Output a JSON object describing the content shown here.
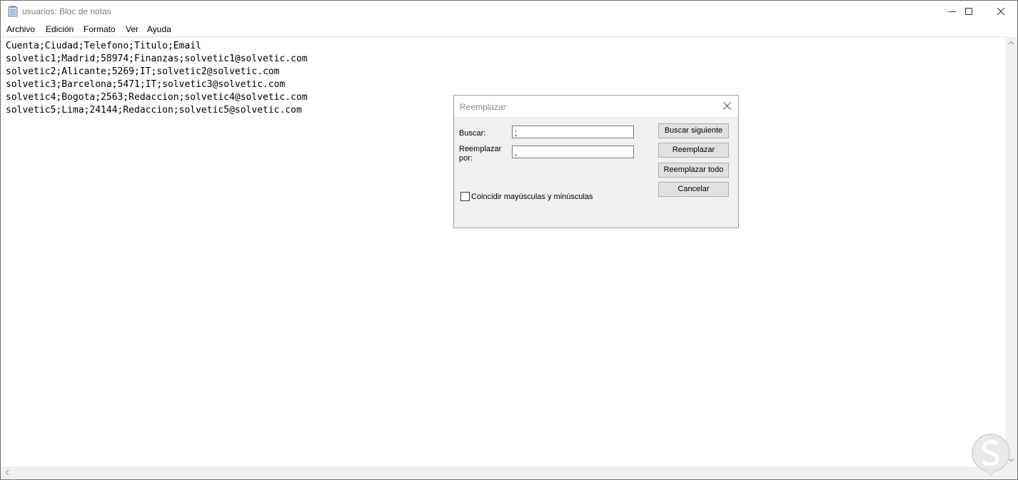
{
  "window": {
    "title": "usuarios: Bloc de notas",
    "icon": "notepad-icon",
    "controls": [
      "minimize-icon",
      "maximize-icon",
      "close-icon"
    ]
  },
  "menu": {
    "items": [
      {
        "label": "Archivo"
      },
      {
        "label": "Edición"
      },
      {
        "label": "Formato"
      },
      {
        "label": "Ver"
      },
      {
        "label": "Ayuda"
      }
    ]
  },
  "editor": {
    "lines": [
      "Cuenta;Ciudad;Telefono;Titulo;Email",
      "solvetic1;Madrid;58974;Finanzas;solvetic1@solvetic.com",
      "solvetic2;Alicante;5269;IT;solvetic2@solvetic.com",
      "solvetic3;Barcelona;5471;IT;solvetic3@solvetic.com",
      "solvetic4;Bogota;2563;Redaccion;solvetic4@solvetic.com",
      "solvetic5;Lima;24144;Redaccion;solvetic5@solvetic.com"
    ]
  },
  "dialog": {
    "title": "Reemplazar",
    "find_label": "Buscar:",
    "find_value": ";",
    "replace_label_line1": "Reemplazar",
    "replace_label_line2": "por:",
    "replace_value": ",",
    "match_case_label": "Coincidir mayúsculas y minúsculas",
    "match_case_checked": false,
    "buttons": {
      "find_next": "Buscar siguiente",
      "replace": "Reemplazar",
      "replace_all": "Reemplazar todo",
      "cancel": "Cancelar"
    }
  },
  "colors": {
    "titlebar_text": "#7a7a7a",
    "dialog_bg": "#f0f0f0",
    "button_bg": "#e1e1e1",
    "scrollbar_bg": "#f0f0f0"
  }
}
